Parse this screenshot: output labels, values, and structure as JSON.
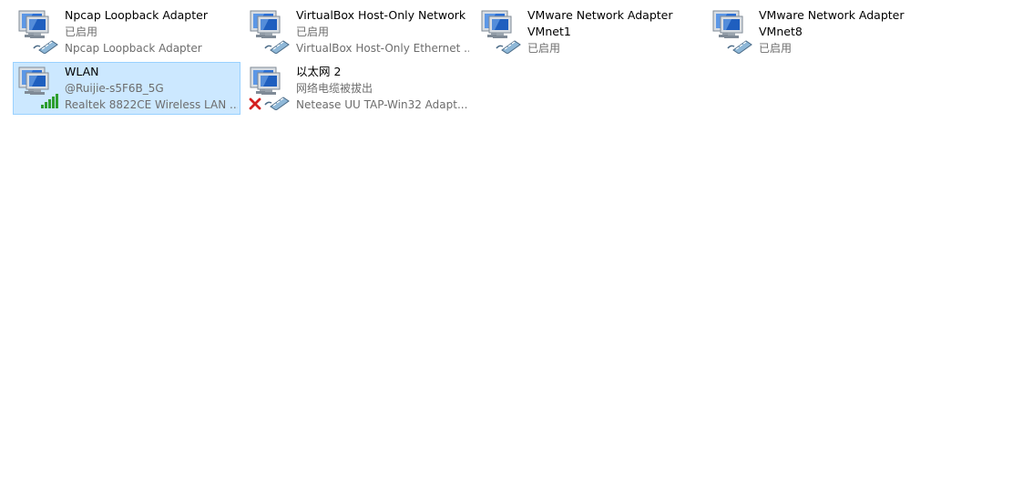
{
  "adapters": [
    {
      "name": "Npcap Loopback Adapter",
      "status": "已启用",
      "device": "Npcap Loopback Adapter",
      "overlay": "cable",
      "selected": false
    },
    {
      "name": "VirtualBox Host-Only Network",
      "status": "已启用",
      "device": "VirtualBox Host-Only Ethernet ...",
      "overlay": "cable",
      "selected": false
    },
    {
      "name": "VMware Network Adapter VMnet1",
      "status": "已启用",
      "device": "",
      "overlay": "cable",
      "selected": false
    },
    {
      "name": "VMware Network Adapter VMnet8",
      "status": "已启用",
      "device": "",
      "overlay": "cable",
      "selected": false
    },
    {
      "name": "WLAN",
      "status": "@Ruijie-s5F6B_5G",
      "device": "Realtek 8822CE Wireless LAN ...",
      "overlay": "wifi-signal",
      "selected": true
    },
    {
      "name": "以太网 2",
      "status": "网络电缆被拔出",
      "device": "Netease UU TAP-Win32 Adapt...",
      "overlay": "disconnected",
      "selected": false
    }
  ],
  "item_labels": [
    {
      "line1": "Npcap Loopback Adapter",
      "line2": "已启用",
      "line3": "Npcap Loopback Adapter"
    },
    {
      "line1": "VirtualBox Host-Only Network",
      "line2": "已启用",
      "line3": "VirtualBox Host-Only Ethernet ..."
    },
    {
      "line1": "VMware Network Adapter",
      "line2": "VMnet1",
      "line3": "已启用"
    },
    {
      "line1": "VMware Network Adapter",
      "line2": "VMnet8",
      "line3": "已启用"
    },
    {
      "line1": "WLAN",
      "line2": "@Ruijie-s5F6B_5G",
      "line3": "Realtek 8822CE Wireless LAN ..."
    },
    {
      "line1": "以太网 2",
      "line2": "网络电缆被拔出",
      "line3": "Netease UU TAP-Win32 Adapt..."
    }
  ],
  "colors": {
    "selection_bg": "#cce8ff",
    "selection_border": "#99d1ff",
    "secondary_text": "#6d6d6d",
    "monitor_blue": "#2a6fd6",
    "signal_green": "#2e9e2e",
    "error_red": "#d42020"
  },
  "icons": {
    "adapter": "network-adapter-icon",
    "cable": "ethernet-cable-icon",
    "wifi": "wifi-signal-icon",
    "disconnected": "red-x-icon"
  }
}
